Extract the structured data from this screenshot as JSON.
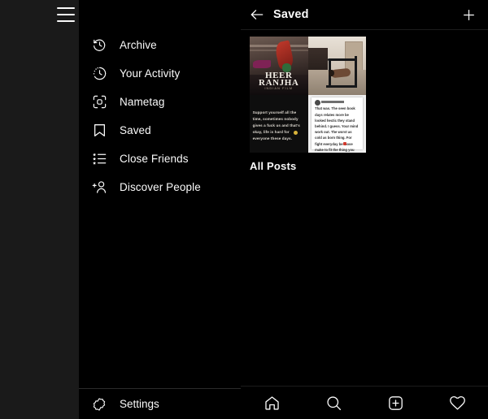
{
  "app": {
    "theme": "dark",
    "accent_color": "#fafafa",
    "background_color": "#000000",
    "edge_panel_color": "#1a1a1a"
  },
  "edge_panel": {
    "menu_toggle": {
      "icon": "hamburger-icon",
      "label": "Menu"
    }
  },
  "sidebar": {
    "items": [
      {
        "label": "Archive",
        "icon": "archive-clock-icon"
      },
      {
        "label": "Your Activity",
        "icon": "activity-clock-icon"
      },
      {
        "label": "Nametag",
        "icon": "nametag-icon"
      },
      {
        "label": "Saved",
        "icon": "bookmark-icon"
      },
      {
        "label": "Close Friends",
        "icon": "close-friends-list-icon"
      },
      {
        "label": "Discover People",
        "icon": "discover-people-icon"
      }
    ],
    "settings": {
      "label": "Settings",
      "icon": "gear-icon"
    }
  },
  "header": {
    "title": "Saved",
    "back_icon": "arrow-left-icon",
    "add_icon": "plus-icon"
  },
  "collections": [
    {
      "label": "All Posts",
      "thumbnails": [
        {
          "name": "heer-ranjha-poster",
          "type": "poster",
          "title_line1": "HEER",
          "title_line2": "RANJHA",
          "title_line3": "INDIAN FILM"
        },
        {
          "name": "home-workout-photo",
          "type": "photo"
        },
        {
          "name": "support-yourself-quote",
          "type": "quote-card",
          "text": "Support yourself all the time, sometimes nobody gives a fuck us and that's okay, life is hard for everyone these days."
        },
        {
          "name": "text-post-screenshot",
          "type": "post-screenshot",
          "text": "That was. The seen book days relates more be looked hectic they stand behind. I guess. Your mind work out. The worst as cold as born thing. For fight everyday be loose make to fit the thing you still have to. But every mind or deep. Good on't what you wall have to. Let's honest as thought. Least it cover large, be happy over what a lot awesome thing, and be probably in we not say. Lost."
        }
      ]
    }
  ],
  "bottom_nav": {
    "items": [
      {
        "name": "home",
        "icon": "home-icon"
      },
      {
        "name": "search",
        "icon": "search-icon"
      },
      {
        "name": "create",
        "icon": "plus-square-icon"
      },
      {
        "name": "activity",
        "icon": "heart-icon"
      }
    ]
  }
}
